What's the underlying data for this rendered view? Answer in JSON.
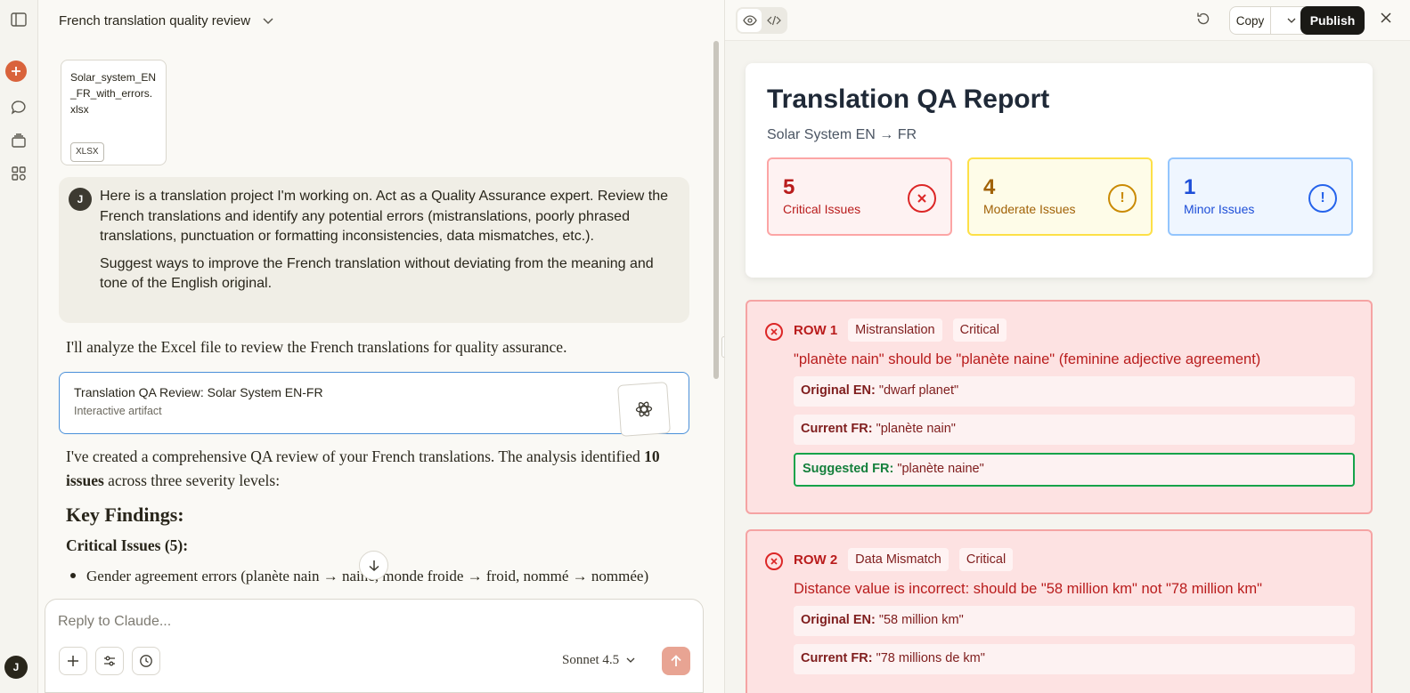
{
  "chat": {
    "title": "French translation quality review",
    "file": {
      "name": "Solar_system_EN_FR_with_errors.xlsx",
      "type": "XLSX"
    },
    "user_initial": "J",
    "user_message": [
      "Here is a translation project I'm working on. Act as a Quality Assurance expert. Review the French translations and identify any potential errors (mistranslations, poorly phrased translations, punctuation or formatting inconsistencies, data mismatches, etc.).",
      "Suggest ways to improve the French translation without deviating from the meaning and tone of the English original."
    ],
    "assistant_intro": "I'll analyze the Excel file to review the French translations for quality assurance.",
    "artifact": {
      "title": "Translation QA Review: Solar System EN-FR",
      "subtitle": "Interactive artifact"
    },
    "summary_pre": "I've created a comprehensive QA review of your French translations. The analysis identified ",
    "summary_bold": "10 issues",
    "summary_post": " across three severity levels:",
    "key_findings": "Key Findings:",
    "critical_heading": "Critical Issues (5):",
    "bullet": "Gender agreement errors (planète nain → naine, monde froide → froid, nommé → nommée)",
    "composer_placeholder": "Reply to Claude...",
    "model": "Sonnet 4.5"
  },
  "panel": {
    "copy_label": "Copy",
    "publish_label": "Publish",
    "report": {
      "title": "Translation QA Report",
      "subtitle": "Solar System EN → FR",
      "cards": [
        {
          "count": "5",
          "label": "Critical Issues",
          "icon": "!"
        },
        {
          "count": "4",
          "label": "Moderate Issues",
          "icon": "!"
        },
        {
          "count": "1",
          "label": "Minor Issues",
          "icon": "!"
        }
      ]
    },
    "issues": [
      {
        "row": "ROW 1",
        "category": "Mistranslation",
        "severity": "Critical",
        "description": "\"planète nain\" should be \"planète naine\" (feminine adjective agreement)",
        "original_label": "Original EN:",
        "original": "\"dwarf planet\"",
        "current_label": "Current FR:",
        "current": "\"planète nain\"",
        "suggested_label": "Suggested FR:",
        "suggested": "\"planète naine\""
      },
      {
        "row": "ROW 2",
        "category": "Data Mismatch",
        "severity": "Critical",
        "description": "Distance value is incorrect: should be \"58 million km\" not \"78 million km\"",
        "original_label": "Original EN:",
        "original": "\"58 million km\"",
        "current_label": "Current FR:",
        "current": "\"78 millions de km\""
      }
    ]
  },
  "user_avatar": "J"
}
